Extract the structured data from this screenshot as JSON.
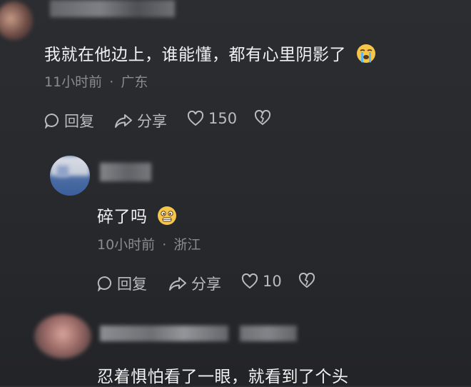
{
  "comments": [
    {
      "text": "我就在他边上，谁能懂，都有心里阴影了",
      "emoji": "crying-face-emoji",
      "time": "11小时前",
      "separator": "·",
      "location": "广东",
      "reply_label": "回复",
      "share_label": "分享",
      "like_count": "150"
    },
    {
      "text": "碎了吗",
      "emoji": "grimacing-face-emoji",
      "time": "10小时前",
      "separator": "·",
      "location": "浙江",
      "reply_label": "回复",
      "share_label": "分享",
      "like_count": "10"
    },
    {
      "text": "忍着惧怕看了一眼，就看到了个头"
    }
  ],
  "colors": {
    "background": "#2a2c30",
    "text": "#f2f2f2",
    "meta": "#8a8c91",
    "action": "#b9bbc0"
  }
}
